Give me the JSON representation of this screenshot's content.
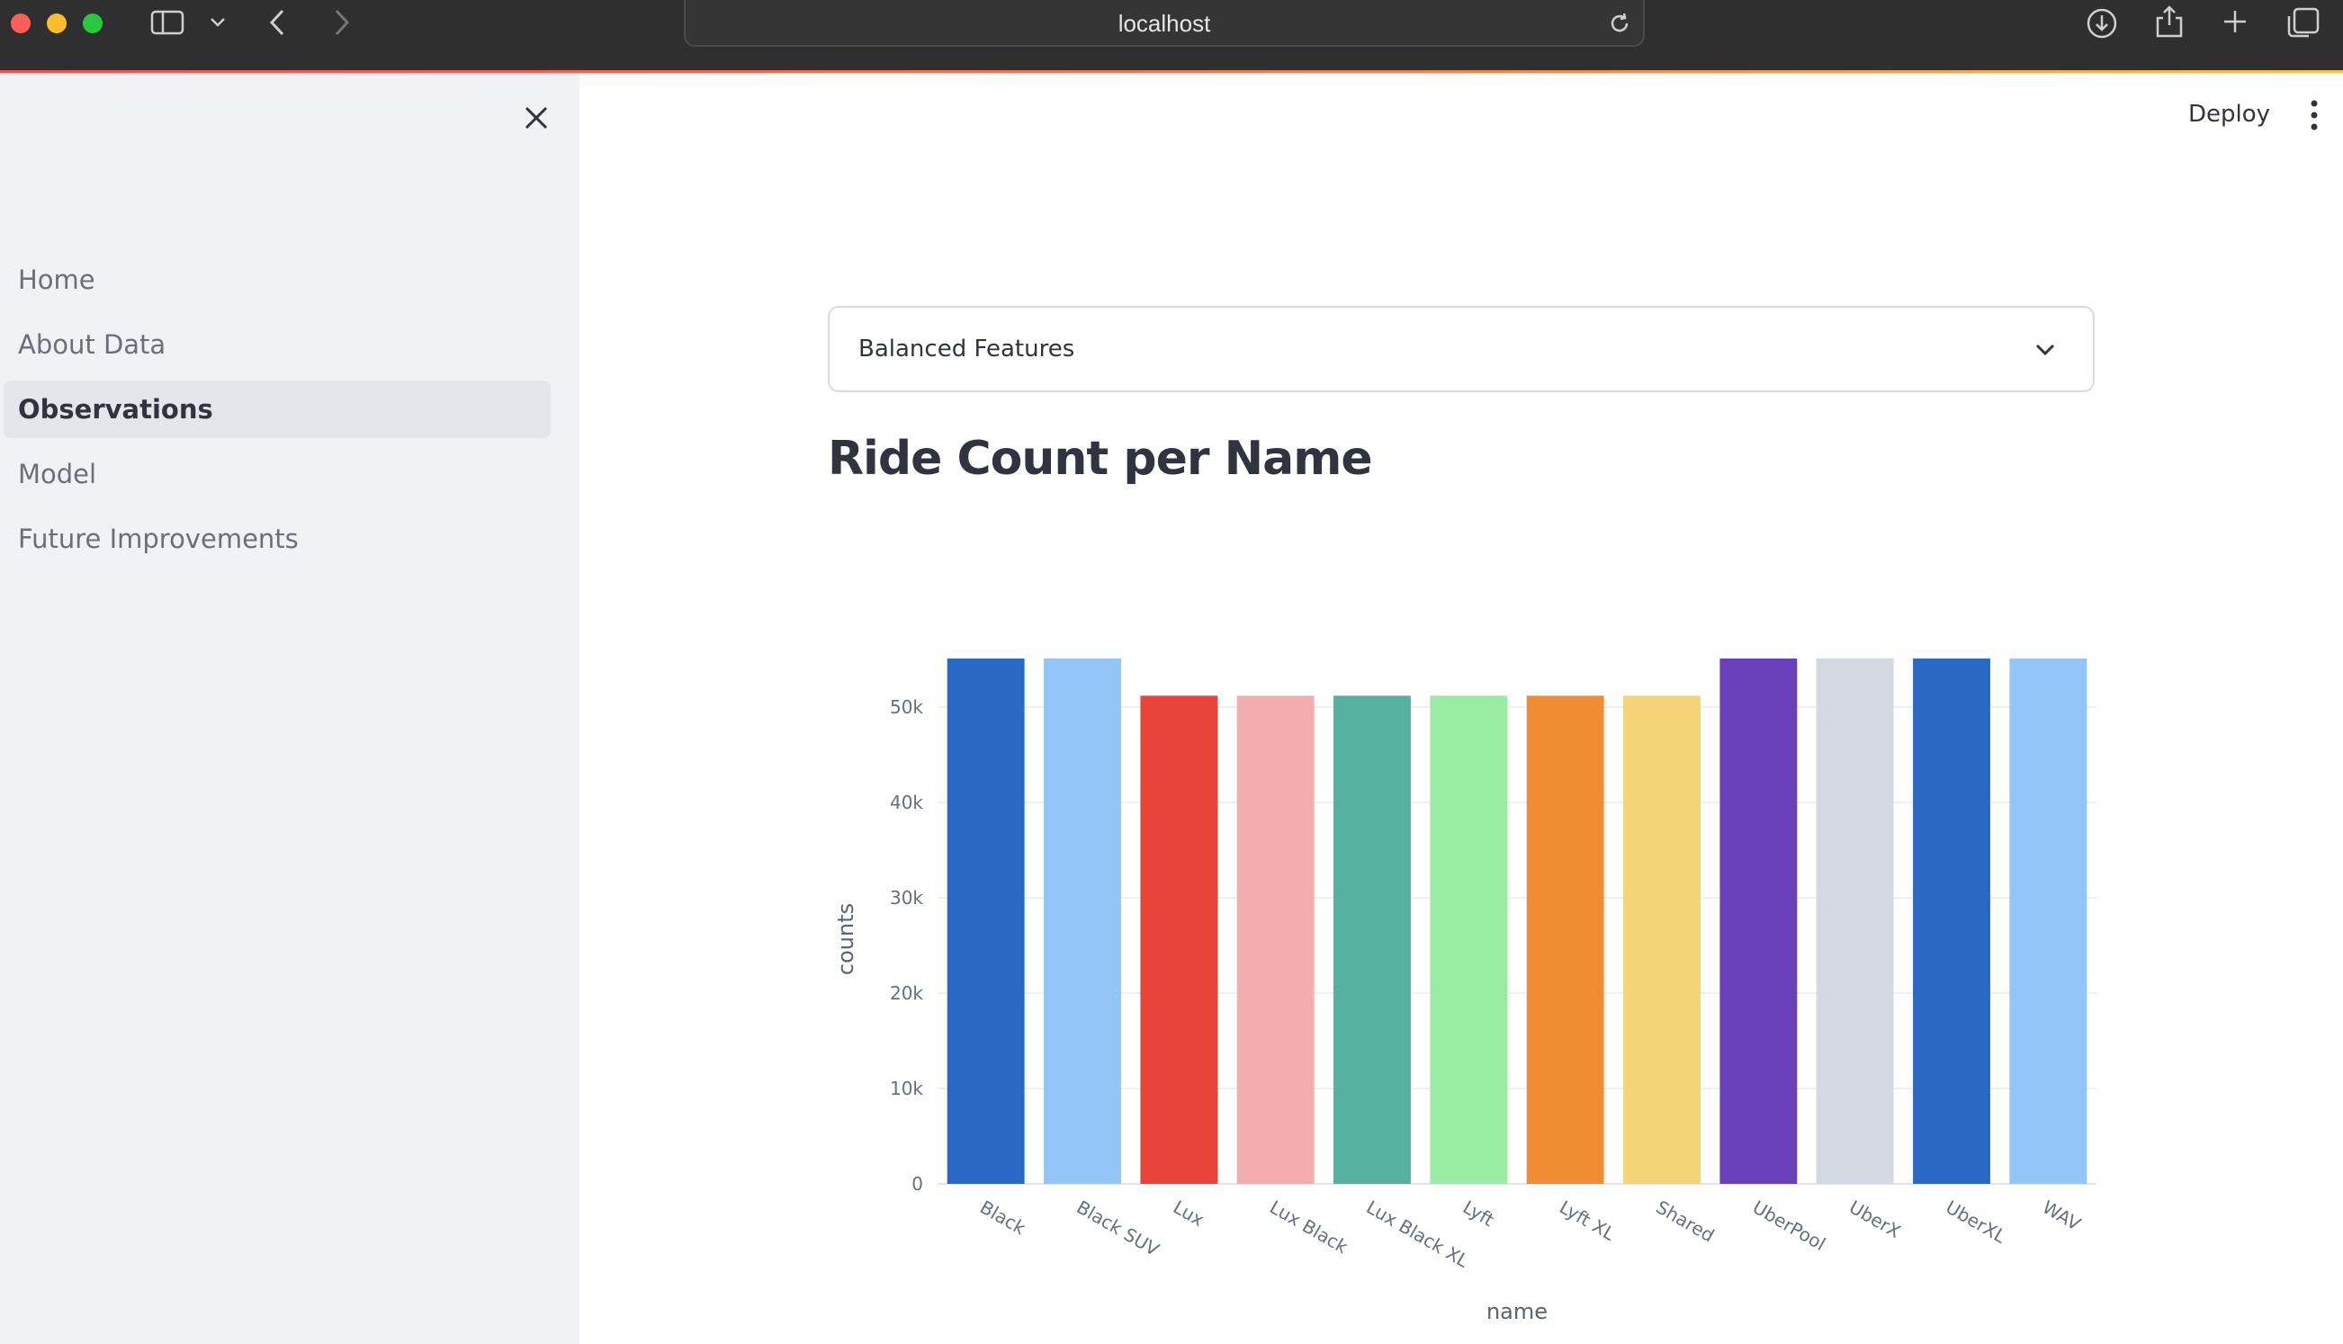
{
  "browser": {
    "url": "localhost",
    "icons": [
      "sidebar-toggle-icon",
      "chevron-down-icon",
      "back-icon",
      "forward-icon",
      "reload-icon",
      "download-icon",
      "share-icon",
      "new-tab-icon",
      "tabs-overview-icon"
    ]
  },
  "sidebar": {
    "items": [
      {
        "label": "Home",
        "active": false
      },
      {
        "label": "About Data",
        "active": false
      },
      {
        "label": "Observations",
        "active": true
      },
      {
        "label": "Model",
        "active": false
      },
      {
        "label": "Future Improvements",
        "active": false
      }
    ]
  },
  "header": {
    "deploy_label": "Deploy"
  },
  "main": {
    "select_value": "Balanced Features",
    "heading": "Ride Count per Name"
  },
  "chart_data": {
    "type": "bar",
    "title": "",
    "xlabel": "name",
    "ylabel": "counts",
    "categories": [
      "Black",
      "Black SUV",
      "Lux",
      "Lux Black",
      "Lux Black XL",
      "Lyft",
      "Lyft XL",
      "Shared",
      "UberPool",
      "UberX",
      "UberXL",
      "WAV"
    ],
    "values": [
      55100,
      55100,
      51200,
      51200,
      51200,
      51200,
      51200,
      51200,
      55100,
      55100,
      55100,
      55100
    ],
    "colors": [
      "#2a68c5",
      "#94c5f8",
      "#e8443a",
      "#f2adac",
      "#55b0a0",
      "#9aeba4",
      "#ef8c34",
      "#f6d377",
      "#6940b7",
      "#d4d8e1",
      "#2a68c5",
      "#94c5f8"
    ],
    "ylim": [
      0,
      55100
    ],
    "yticks": [
      0,
      10000,
      20000,
      30000,
      40000,
      50000
    ],
    "ytick_labels": [
      "0",
      "10k",
      "20k",
      "30k",
      "40k",
      "50k"
    ],
    "grid": true,
    "legend": "none"
  }
}
